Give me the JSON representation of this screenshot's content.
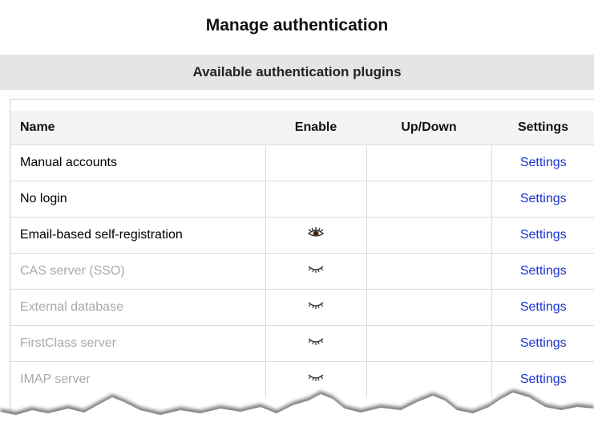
{
  "page": {
    "title": "Manage authentication",
    "section_heading": "Available authentication plugins"
  },
  "table": {
    "headers": {
      "name": "Name",
      "enable": "Enable",
      "updown": "Up/Down",
      "settings": "Settings"
    },
    "rows": [
      {
        "name": "Manual accounts",
        "enable_icon": "none",
        "settings_label": "Settings",
        "state": "system"
      },
      {
        "name": "No login",
        "enable_icon": "none",
        "settings_label": "Settings",
        "state": "system"
      },
      {
        "name": "Email-based self-registration",
        "enable_icon": "eye-open-icon",
        "settings_label": "Settings",
        "state": "enabled"
      },
      {
        "name": "CAS server (SSO)",
        "enable_icon": "eye-closed-icon",
        "settings_label": "Settings",
        "state": "disabled"
      },
      {
        "name": "External database",
        "enable_icon": "eye-closed-icon",
        "settings_label": "Settings",
        "state": "disabled"
      },
      {
        "name": "FirstClass server",
        "enable_icon": "eye-closed-icon",
        "settings_label": "Settings",
        "state": "disabled"
      },
      {
        "name": "IMAP server",
        "enable_icon": "eye-closed-icon",
        "settings_label": "Settings",
        "state": "disabled"
      }
    ]
  },
  "colors": {
    "link": "#1a33cc",
    "disabled_text": "#a9a9a9",
    "heading_band": "#e5e5e5"
  }
}
